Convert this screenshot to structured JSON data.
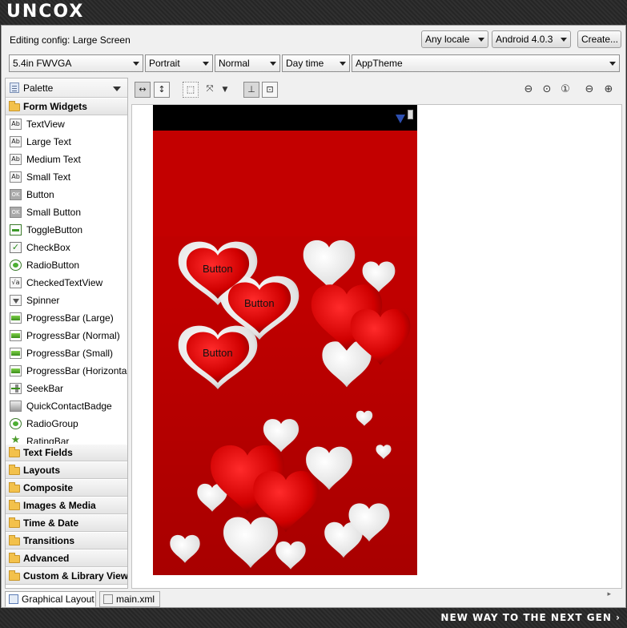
{
  "banner": {
    "brand": "UNCOX",
    "slogan": "NEW WAY TO THE NEXT GEN ›"
  },
  "config": {
    "editing_label": "Editing config:  Large Screen",
    "locale": "Any locale",
    "android_version": "Android 4.0.3",
    "create_button": "Create..."
  },
  "combos": {
    "device": "5.4in FWVGA",
    "orientation": "Portrait",
    "dock_mode": "Normal",
    "night_mode": "Day time",
    "theme": "AppTheme"
  },
  "palette": {
    "title": "Palette",
    "open_category": "Form Widgets",
    "widgets": [
      {
        "label": "TextView",
        "icon": "textview-icon"
      },
      {
        "label": "Large Text",
        "icon": "textview-icon"
      },
      {
        "label": "Medium Text",
        "icon": "textview-icon"
      },
      {
        "label": "Small Text",
        "icon": "textview-icon"
      },
      {
        "label": "Button",
        "icon": "button-icon"
      },
      {
        "label": "Small Button",
        "icon": "button-icon"
      },
      {
        "label": "ToggleButton",
        "icon": "toggle-icon"
      },
      {
        "label": "CheckBox",
        "icon": "checkbox-icon"
      },
      {
        "label": "RadioButton",
        "icon": "radio-icon"
      },
      {
        "label": "CheckedTextView",
        "icon": "checked-text-icon"
      },
      {
        "label": "Spinner",
        "icon": "spinner-icon"
      },
      {
        "label": "ProgressBar (Large)",
        "icon": "progressbar-icon"
      },
      {
        "label": "ProgressBar (Normal)",
        "icon": "progressbar-icon"
      },
      {
        "label": "ProgressBar (Small)",
        "icon": "progressbar-icon"
      },
      {
        "label": "ProgressBar (Horizontal)",
        "icon": "progressbar-icon"
      },
      {
        "label": "SeekBar",
        "icon": "seekbar-icon"
      },
      {
        "label": "QuickContactBadge",
        "icon": "badge-icon"
      },
      {
        "label": "RadioGroup",
        "icon": "radiogroup-icon"
      },
      {
        "label": "RatingBar",
        "icon": "star-icon"
      }
    ],
    "categories": [
      "Text Fields",
      "Layouts",
      "Composite",
      "Images & Media",
      "Time & Date",
      "Transitions",
      "Advanced",
      "Custom & Library Views"
    ]
  },
  "preview": {
    "buttons": [
      "Button",
      "Button",
      "Button"
    ],
    "accent": "#c00000"
  },
  "tabs": {
    "graphical": "Graphical Layout",
    "xml": "main.xml"
  }
}
